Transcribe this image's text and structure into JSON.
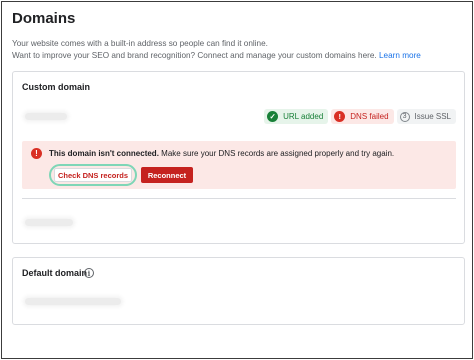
{
  "page": {
    "title": "Domains",
    "subtitle_line1": "Your website comes with a built-in address so people can find it online.",
    "subtitle_line2": "Want to improve your SEO and brand recognition? Connect and manage your custom domains here.",
    "learn_more": "Learn more"
  },
  "custom_domain": {
    "title": "Custom domain",
    "statuses": [
      {
        "label": "URL added",
        "state": "ok",
        "icon": "check-icon"
      },
      {
        "label": "DNS failed",
        "state": "failed",
        "icon": "exclamation-icon"
      },
      {
        "label": "Issue SSL",
        "state": "pending",
        "step": "3"
      }
    ],
    "alert": {
      "title": "This domain isn't connected.",
      "message": "Make sure your DNS records are assigned properly and try again.",
      "check_button": "Check DNS records",
      "reconnect_button": "Reconnect"
    }
  },
  "default_domain": {
    "title": "Default domain",
    "info_icon": "info-icon"
  },
  "colors": {
    "accent": "#1a73e8",
    "success": "#188038",
    "error": "#c5221f",
    "focus_ring": "#7fd6b7"
  }
}
